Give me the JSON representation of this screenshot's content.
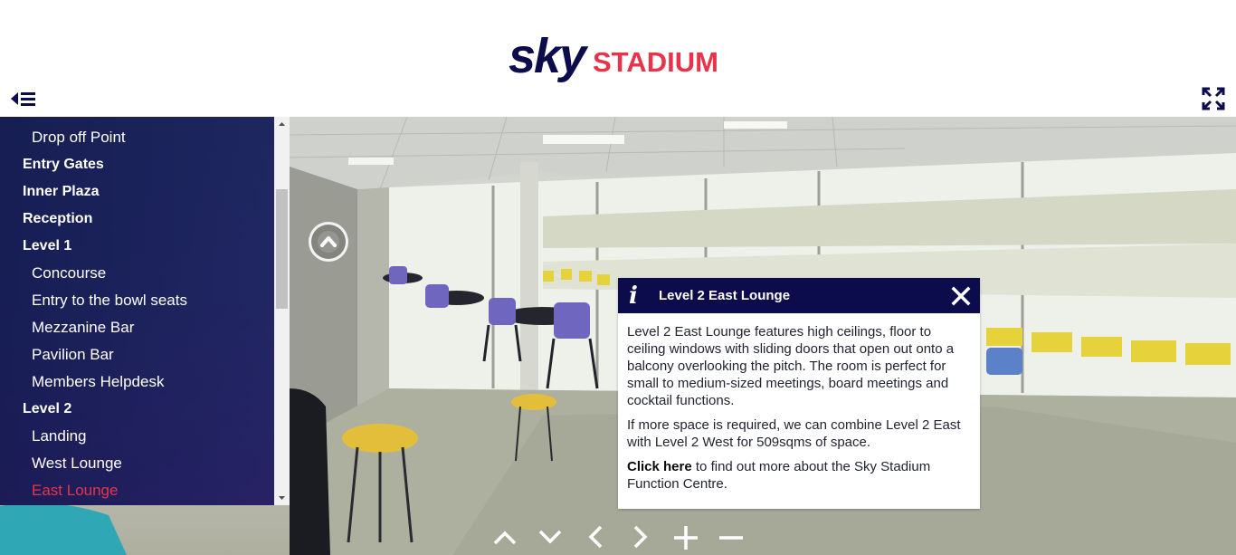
{
  "header": {
    "logo_text_sky": "sky",
    "logo_text_stadium": "STADIUM",
    "menu_icon": "menu-collapse-icon",
    "fullscreen_icon": "fullscreen-icon"
  },
  "colors": {
    "brand_navy": "#0c0b4b",
    "brand_red": "#e8334a",
    "sidebar_bg": "#1f2a63"
  },
  "sidebar": {
    "items": [
      {
        "label": "Drop off Point",
        "level": "sub",
        "active": false
      },
      {
        "label": "Entry Gates",
        "level": "top",
        "active": false
      },
      {
        "label": "Inner Plaza",
        "level": "top",
        "active": false
      },
      {
        "label": "Reception",
        "level": "top",
        "active": false
      },
      {
        "label": "Level 1",
        "level": "top",
        "active": false
      },
      {
        "label": "Concourse",
        "level": "sub",
        "active": false
      },
      {
        "label": "Entry to the bowl seats",
        "level": "sub",
        "active": false
      },
      {
        "label": "Mezzanine Bar",
        "level": "sub",
        "active": false
      },
      {
        "label": "Pavilion Bar",
        "level": "sub",
        "active": false
      },
      {
        "label": "Members Helpdesk",
        "level": "sub",
        "active": false
      },
      {
        "label": "Level 2",
        "level": "top",
        "active": false
      },
      {
        "label": "Landing",
        "level": "sub",
        "active": false
      },
      {
        "label": "West Lounge",
        "level": "sub",
        "active": false
      },
      {
        "label": "East Lounge",
        "level": "sub",
        "active": true
      }
    ]
  },
  "popup": {
    "title": "Level 2 East Lounge",
    "paragraph1": "Level 2 East Lounge features high ceilings, floor to ceiling windows with sliding doors that open out onto a balcony overlooking the pitch. The room is perfect for small to medium-sized meetings, board meetings and cocktail functions.",
    "paragraph2": "If more space is required, we can combine Level 2 East with Level 2 West for 509sqms of space.",
    "link_text": "Click here",
    "link_suffix": " to find out more about the Sky Stadium Function Centre."
  },
  "controls": [
    "tilt-up-icon",
    "tilt-down-icon",
    "pan-left-icon",
    "pan-right-icon",
    "zoom-in-icon",
    "zoom-out-icon"
  ]
}
